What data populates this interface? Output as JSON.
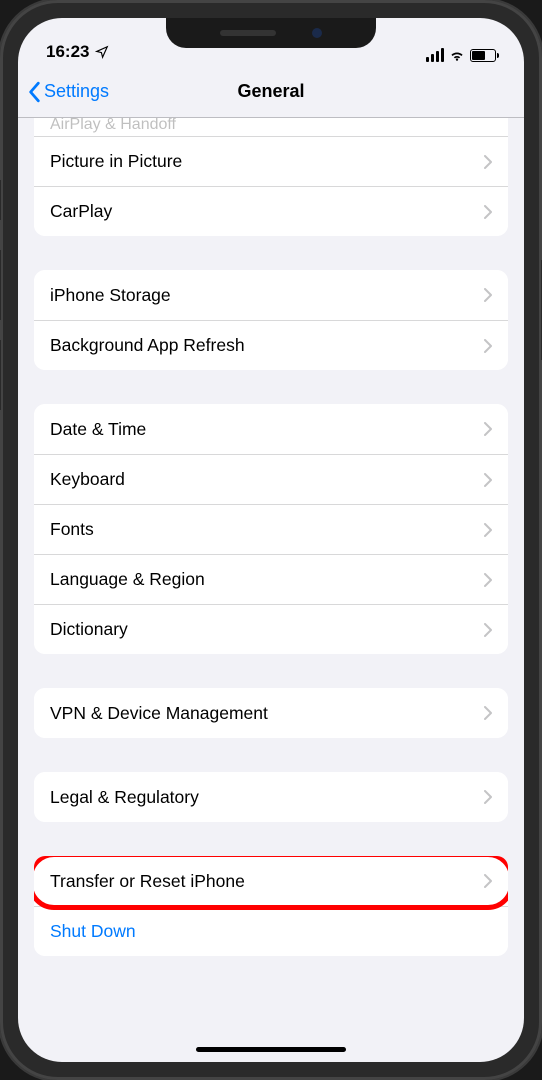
{
  "statusbar": {
    "time": "16:23"
  },
  "navbar": {
    "back": "Settings",
    "title": "General"
  },
  "groups": [
    {
      "partialTop": "AirPlay & Handoff",
      "items": [
        {
          "label": "Picture in Picture",
          "name": "row-picture-in-picture"
        },
        {
          "label": "CarPlay",
          "name": "row-carplay"
        }
      ]
    },
    {
      "items": [
        {
          "label": "iPhone Storage",
          "name": "row-iphone-storage"
        },
        {
          "label": "Background App Refresh",
          "name": "row-background-app-refresh"
        }
      ]
    },
    {
      "items": [
        {
          "label": "Date & Time",
          "name": "row-date-time"
        },
        {
          "label": "Keyboard",
          "name": "row-keyboard"
        },
        {
          "label": "Fonts",
          "name": "row-fonts"
        },
        {
          "label": "Language & Region",
          "name": "row-language-region"
        },
        {
          "label": "Dictionary",
          "name": "row-dictionary"
        }
      ]
    },
    {
      "items": [
        {
          "label": "VPN & Device Management",
          "name": "row-vpn-device-management"
        }
      ]
    },
    {
      "items": [
        {
          "label": "Legal & Regulatory",
          "name": "row-legal-regulatory"
        }
      ]
    },
    {
      "items": [
        {
          "label": "Transfer or Reset iPhone",
          "name": "row-transfer-reset-iphone",
          "highlight": true
        },
        {
          "label": "Shut Down",
          "name": "row-shut-down",
          "link": true
        }
      ]
    }
  ]
}
